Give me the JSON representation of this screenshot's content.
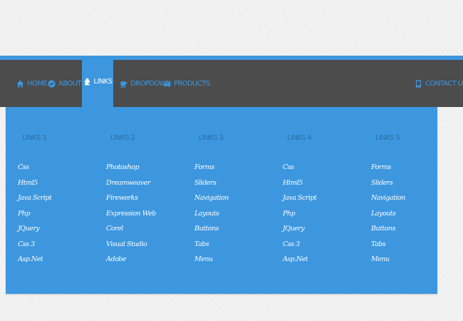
{
  "colors": {
    "page_background": "#f1f1f1",
    "navbar_background": "#4c4c4c",
    "accent": "#3d97df",
    "active_text": "#ffffff",
    "column_title": "#2a6fa6",
    "link_text": "#ffffff"
  },
  "nav": {
    "items": [
      {
        "label": "HOME",
        "icon": "home-icon"
      },
      {
        "label": "ABOUT US",
        "icon": "check-circle-icon"
      },
      {
        "label": "LINKS",
        "icon": "puzzle-icon",
        "active": true
      },
      {
        "label": "DROPDOWN",
        "icon": "coffee-cup-icon"
      },
      {
        "label": "PRODUCTS",
        "icon": "car-icon"
      },
      {
        "label": "CONTACT US",
        "icon": "phone-icon"
      }
    ]
  },
  "mega_menu": {
    "columns": [
      {
        "title": "LINKS 1",
        "links": [
          "Css",
          "Html5",
          "Java Script",
          "Php",
          "JQuery",
          "Css 3",
          "Asp.Net"
        ]
      },
      {
        "title": "LINKS 2",
        "links": [
          "Photoshop",
          "Dreamweaver",
          "Fireworks",
          "Expression Web",
          "Corel",
          "Visual Studio",
          "Adobe"
        ]
      },
      {
        "title": "LINKS 3",
        "links": [
          "Forms",
          "Sliders",
          "Navigation",
          "Layouts",
          "Buttons",
          "Tabs",
          "Menu"
        ]
      },
      {
        "title": "LINKS 4",
        "links": [
          "Css",
          "Html5",
          "Java Script",
          "Php",
          "JQuery",
          "Css 3",
          "Asp.Net"
        ]
      },
      {
        "title": "LINKS 5",
        "links": [
          "Forms",
          "Sliders",
          "Navigation",
          "Layouts",
          "Buttons",
          "Tabs",
          "Menu"
        ]
      }
    ]
  }
}
